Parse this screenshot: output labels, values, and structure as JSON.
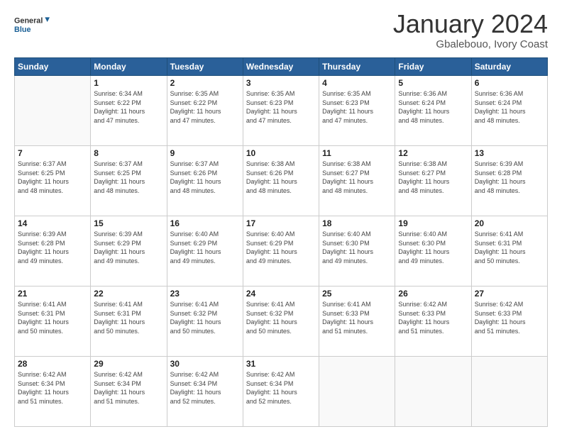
{
  "logo": {
    "text_general": "General",
    "text_blue": "Blue"
  },
  "header": {
    "title": "January 2024",
    "subtitle": "Gbalebouo, Ivory Coast"
  },
  "days_of_week": [
    "Sunday",
    "Monday",
    "Tuesday",
    "Wednesday",
    "Thursday",
    "Friday",
    "Saturday"
  ],
  "weeks": [
    [
      {
        "day": "",
        "info": ""
      },
      {
        "day": "1",
        "info": "Sunrise: 6:34 AM\nSunset: 6:22 PM\nDaylight: 11 hours\nand 47 minutes."
      },
      {
        "day": "2",
        "info": "Sunrise: 6:35 AM\nSunset: 6:22 PM\nDaylight: 11 hours\nand 47 minutes."
      },
      {
        "day": "3",
        "info": "Sunrise: 6:35 AM\nSunset: 6:23 PM\nDaylight: 11 hours\nand 47 minutes."
      },
      {
        "day": "4",
        "info": "Sunrise: 6:35 AM\nSunset: 6:23 PM\nDaylight: 11 hours\nand 47 minutes."
      },
      {
        "day": "5",
        "info": "Sunrise: 6:36 AM\nSunset: 6:24 PM\nDaylight: 11 hours\nand 48 minutes."
      },
      {
        "day": "6",
        "info": "Sunrise: 6:36 AM\nSunset: 6:24 PM\nDaylight: 11 hours\nand 48 minutes."
      }
    ],
    [
      {
        "day": "7",
        "info": "Sunrise: 6:37 AM\nSunset: 6:25 PM\nDaylight: 11 hours\nand 48 minutes."
      },
      {
        "day": "8",
        "info": "Sunrise: 6:37 AM\nSunset: 6:25 PM\nDaylight: 11 hours\nand 48 minutes."
      },
      {
        "day": "9",
        "info": "Sunrise: 6:37 AM\nSunset: 6:26 PM\nDaylight: 11 hours\nand 48 minutes."
      },
      {
        "day": "10",
        "info": "Sunrise: 6:38 AM\nSunset: 6:26 PM\nDaylight: 11 hours\nand 48 minutes."
      },
      {
        "day": "11",
        "info": "Sunrise: 6:38 AM\nSunset: 6:27 PM\nDaylight: 11 hours\nand 48 minutes."
      },
      {
        "day": "12",
        "info": "Sunrise: 6:38 AM\nSunset: 6:27 PM\nDaylight: 11 hours\nand 48 minutes."
      },
      {
        "day": "13",
        "info": "Sunrise: 6:39 AM\nSunset: 6:28 PM\nDaylight: 11 hours\nand 48 minutes."
      }
    ],
    [
      {
        "day": "14",
        "info": "Sunrise: 6:39 AM\nSunset: 6:28 PM\nDaylight: 11 hours\nand 49 minutes."
      },
      {
        "day": "15",
        "info": "Sunrise: 6:39 AM\nSunset: 6:29 PM\nDaylight: 11 hours\nand 49 minutes."
      },
      {
        "day": "16",
        "info": "Sunrise: 6:40 AM\nSunset: 6:29 PM\nDaylight: 11 hours\nand 49 minutes."
      },
      {
        "day": "17",
        "info": "Sunrise: 6:40 AM\nSunset: 6:29 PM\nDaylight: 11 hours\nand 49 minutes."
      },
      {
        "day": "18",
        "info": "Sunrise: 6:40 AM\nSunset: 6:30 PM\nDaylight: 11 hours\nand 49 minutes."
      },
      {
        "day": "19",
        "info": "Sunrise: 6:40 AM\nSunset: 6:30 PM\nDaylight: 11 hours\nand 49 minutes."
      },
      {
        "day": "20",
        "info": "Sunrise: 6:41 AM\nSunset: 6:31 PM\nDaylight: 11 hours\nand 50 minutes."
      }
    ],
    [
      {
        "day": "21",
        "info": "Sunrise: 6:41 AM\nSunset: 6:31 PM\nDaylight: 11 hours\nand 50 minutes."
      },
      {
        "day": "22",
        "info": "Sunrise: 6:41 AM\nSunset: 6:31 PM\nDaylight: 11 hours\nand 50 minutes."
      },
      {
        "day": "23",
        "info": "Sunrise: 6:41 AM\nSunset: 6:32 PM\nDaylight: 11 hours\nand 50 minutes."
      },
      {
        "day": "24",
        "info": "Sunrise: 6:41 AM\nSunset: 6:32 PM\nDaylight: 11 hours\nand 50 minutes."
      },
      {
        "day": "25",
        "info": "Sunrise: 6:41 AM\nSunset: 6:33 PM\nDaylight: 11 hours\nand 51 minutes."
      },
      {
        "day": "26",
        "info": "Sunrise: 6:42 AM\nSunset: 6:33 PM\nDaylight: 11 hours\nand 51 minutes."
      },
      {
        "day": "27",
        "info": "Sunrise: 6:42 AM\nSunset: 6:33 PM\nDaylight: 11 hours\nand 51 minutes."
      }
    ],
    [
      {
        "day": "28",
        "info": "Sunrise: 6:42 AM\nSunset: 6:34 PM\nDaylight: 11 hours\nand 51 minutes."
      },
      {
        "day": "29",
        "info": "Sunrise: 6:42 AM\nSunset: 6:34 PM\nDaylight: 11 hours\nand 51 minutes."
      },
      {
        "day": "30",
        "info": "Sunrise: 6:42 AM\nSunset: 6:34 PM\nDaylight: 11 hours\nand 52 minutes."
      },
      {
        "day": "31",
        "info": "Sunrise: 6:42 AM\nSunset: 6:34 PM\nDaylight: 11 hours\nand 52 minutes."
      },
      {
        "day": "",
        "info": ""
      },
      {
        "day": "",
        "info": ""
      },
      {
        "day": "",
        "info": ""
      }
    ]
  ]
}
